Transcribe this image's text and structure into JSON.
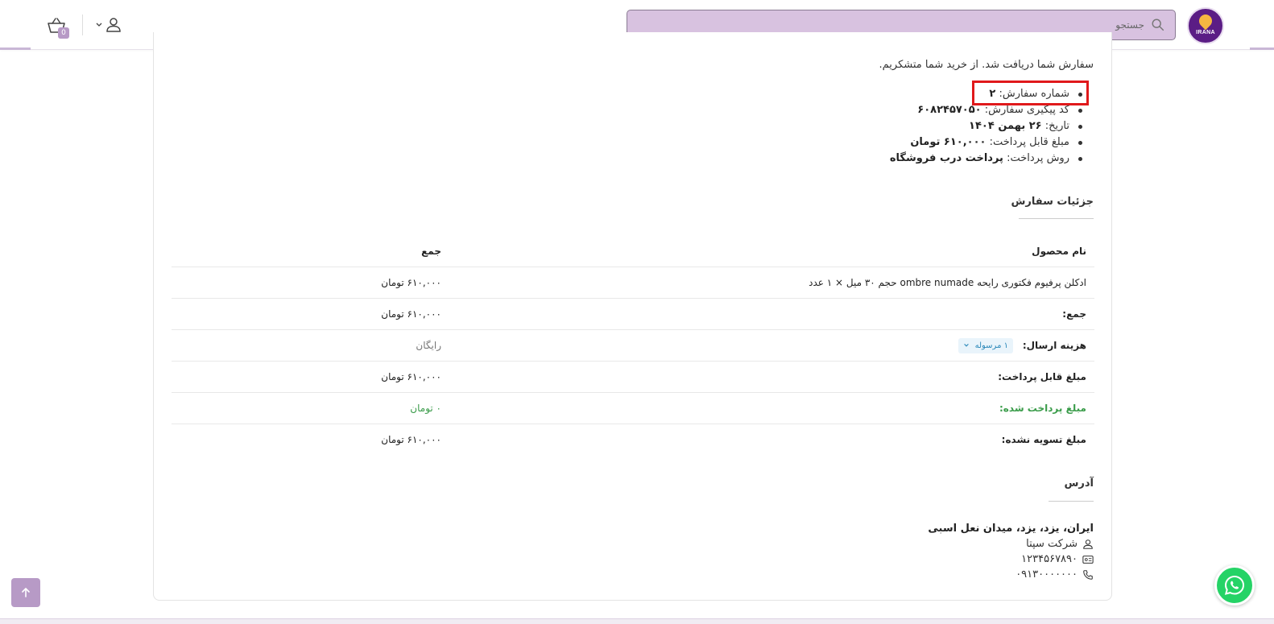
{
  "header": {
    "logo_text": "IRANA",
    "search_placeholder": "جستجو",
    "cart_count": "0"
  },
  "order": {
    "thanks_message": "سفارش شما دریافت شد. از خرید شما متشکریم.",
    "summary": [
      {
        "label": "شماره سفارش:",
        "value": "۲"
      },
      {
        "label": "کد پیگیری سفارش:",
        "value": "۶۰۸۲۴۵۷۰۵۰"
      },
      {
        "label": "تاریخ:",
        "value": "۲۶ بهمن ۱۴۰۴"
      },
      {
        "label": "مبلغ قابل پرداخت:",
        "value": "۶۱۰,۰۰۰ تومان"
      },
      {
        "label": "روش پرداخت:",
        "value": "پرداخت درب فروشگاه"
      }
    ]
  },
  "details": {
    "title": "جزئیات سفارش",
    "col_product": "نام محصول",
    "col_total": "جمع",
    "rows": [
      {
        "label": "ادکلن پرفیوم فکتوری رایحه ombre numade حجم ۳۰ میل × ۱ عدد",
        "value": "۶۱۰,۰۰۰ تومان"
      },
      {
        "label": "جمع:",
        "value": "۶۱۰,۰۰۰ تومان"
      },
      {
        "label": "هزینه ارسال:",
        "pill": "۱ مرسوله",
        "value": "رایگان"
      },
      {
        "label": "مبلغ قابل پرداخت:",
        "value": "۶۱۰,۰۰۰ تومان"
      },
      {
        "label": "مبلغ پرداخت شده:",
        "value": "۰ تومان"
      },
      {
        "label": "مبلغ تسویه نشده:",
        "value": "۶۱۰,۰۰۰ تومان"
      }
    ]
  },
  "address": {
    "title": "آدرس",
    "location": "ایران، یزد، یزد، میدان نعل اسبی",
    "company": "شرکت سپتا",
    "postal": "۱۲۳۴۵۶۷۸۹۰",
    "phone": "۰۹۱۳۰۰۰۰۰۰۰"
  },
  "colors": {
    "accent": "#b79ac6",
    "search_bg": "#d8c2e0",
    "paid_green": "#3a9c4a",
    "highlight": "#e0191b",
    "whatsapp": "#25d366"
  }
}
